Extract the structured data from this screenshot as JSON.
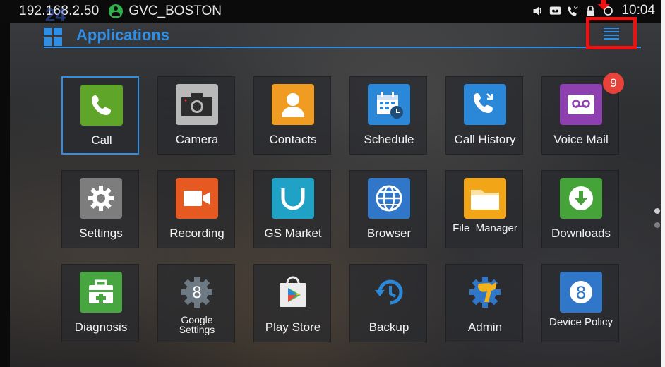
{
  "status_bar": {
    "ip_address": "192.168.2.50",
    "account_name": "GVC_BOSTON",
    "time": "10:04",
    "icons": [
      "volume-icon",
      "voicemail-icon",
      "missed-call-icon",
      "lock-icon",
      "sync-icon"
    ]
  },
  "app_bar": {
    "title": "Applications",
    "watermark": "24",
    "menu_icon": "menu-list-icon",
    "accent_color": "#2f8fe6",
    "highlight_color": "#ee1111"
  },
  "apps": [
    {
      "label": "Call",
      "icon": "phone-icon",
      "color": "#5fa52a",
      "selected": true
    },
    {
      "label": "Camera",
      "icon": "camera-icon",
      "color": "#b8b8b8"
    },
    {
      "label": "Contacts",
      "icon": "contacts-icon",
      "color": "#f09b22"
    },
    {
      "label": "Schedule",
      "icon": "calendar-icon",
      "color": "#2b88d8"
    },
    {
      "label": "Call History",
      "icon": "call-history-icon",
      "color": "#2b88d8"
    },
    {
      "label": "Voice Mail",
      "icon": "voicemail-icon",
      "color": "#8e3fb0",
      "badge": "9"
    },
    {
      "label": "Settings",
      "icon": "gear-icon",
      "color": "#7d7d7d"
    },
    {
      "label": "Recording",
      "icon": "video-camera-icon",
      "color": "#e65a22"
    },
    {
      "label": "GS Market",
      "icon": "market-bag-icon",
      "color": "#20a2c6"
    },
    {
      "label": "Browser",
      "icon": "globe-icon",
      "color": "#3177c9"
    },
    {
      "label": "File  Manager",
      "icon": "folder-icon",
      "color": "#f2a516"
    },
    {
      "label": "Downloads",
      "icon": "download-icon",
      "color": "#46a33a"
    },
    {
      "label": "Diagnosis",
      "icon": "first-aid-icon",
      "color": "#48a641"
    },
    {
      "label": "Google Settings",
      "icon": "google-settings-icon",
      "color": "#6d7a84"
    },
    {
      "label": "Play Store",
      "icon": "play-store-icon",
      "color": "#ececec"
    },
    {
      "label": "Backup",
      "icon": "backup-restore-icon",
      "color": "#2b88d8"
    },
    {
      "label": "Admin",
      "icon": "admin-wrench-icon",
      "color": "#f3b21c"
    },
    {
      "label": "Device Policy",
      "icon": "device-policy-icon",
      "color": "#3177c9"
    }
  ]
}
